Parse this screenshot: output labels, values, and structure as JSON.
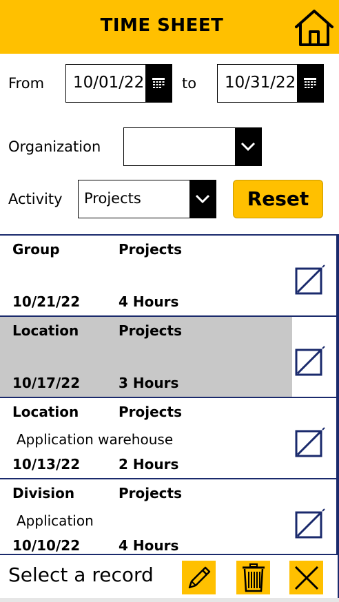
{
  "header": {
    "title": "TIME SHEET",
    "home_icon": "home-icon"
  },
  "filters": {
    "from_label": "From",
    "from_value": "10/01/22",
    "to_label": "to",
    "to_value": "10/31/22",
    "organization_label": "Organization",
    "organization_value": "",
    "activity_label": "Activity",
    "activity_value": "Projects",
    "reset_label": "Reset"
  },
  "records": [
    {
      "title": "Group",
      "activity": "Projects",
      "description": "",
      "date": "10/21/22",
      "hours": "4 Hours",
      "selected": false
    },
    {
      "title": "Location",
      "activity": "Projects",
      "description": "",
      "date": "10/17/22",
      "hours": "3 Hours",
      "selected": true
    },
    {
      "title": "Location",
      "activity": "Projects",
      "description": "Application warehouse",
      "date": "10/13/22",
      "hours": "2 Hours",
      "selected": false
    },
    {
      "title": "Division",
      "activity": "Projects",
      "description": "Application",
      "date": "10/10/22",
      "hours": "4 Hours",
      "selected": false
    }
  ],
  "footer": {
    "status_text": "Select a record",
    "icons": [
      "pencil-icon",
      "trash-icon",
      "close-icon"
    ]
  },
  "colors": {
    "accent": "#ffc000",
    "border": "#1a2a6c",
    "selected_row": "#c8c8c8"
  }
}
